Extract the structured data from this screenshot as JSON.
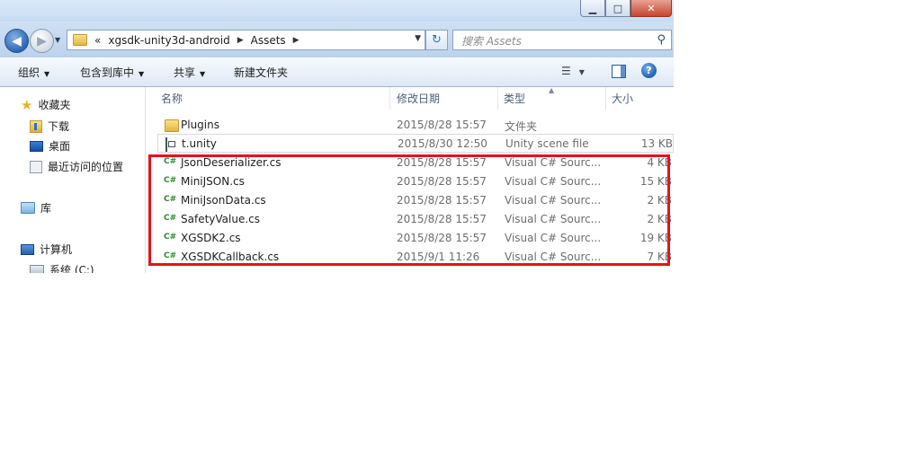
{
  "window": {
    "caption_buttons": {
      "minimize": "▁",
      "maximize": "□",
      "close": "✕"
    }
  },
  "address": {
    "overflow_marker": "«",
    "crumbs": [
      "xgsdk-unity3d-android",
      "Assets"
    ],
    "search_placeholder": "搜索 Assets"
  },
  "toolbar": {
    "organize": "组织",
    "include_in_library": "包含到库中",
    "share": "共享",
    "new_folder": "新建文件夹"
  },
  "nav": {
    "favorites": "收藏夹",
    "downloads": "下载",
    "desktop": "桌面",
    "recent": "最近访问的位置",
    "libraries": "库",
    "computer": "计算机",
    "drive_c": "系统 (C:)"
  },
  "columns": {
    "name": "名称",
    "date": "修改日期",
    "type": "类型",
    "size": "大小"
  },
  "files": [
    {
      "name": "Plugins",
      "date": "2015/8/28 15:57",
      "type": "文件夹",
      "size": "",
      "icon": "folder-icon"
    },
    {
      "name": "t.unity",
      "date": "2015/8/30 12:50",
      "type": "Unity scene file",
      "size": "13 KB",
      "icon": "unity-file-icon"
    },
    {
      "name": "JsonDeserializer.cs",
      "date": "2015/8/28 15:57",
      "type": "Visual C# Sourc...",
      "size": "4 KB",
      "icon": "csharp-file-icon"
    },
    {
      "name": "MiniJSON.cs",
      "date": "2015/8/28 15:57",
      "type": "Visual C# Sourc...",
      "size": "15 KB",
      "icon": "csharp-file-icon"
    },
    {
      "name": "MiniJsonData.cs",
      "date": "2015/8/28 15:57",
      "type": "Visual C# Sourc...",
      "size": "2 KB",
      "icon": "csharp-file-icon"
    },
    {
      "name": "SafetyValue.cs",
      "date": "2015/8/28 15:57",
      "type": "Visual C# Sourc...",
      "size": "2 KB",
      "icon": "csharp-file-icon"
    },
    {
      "name": "XGSDK2.cs",
      "date": "2015/8/28 15:57",
      "type": "Visual C# Sourc...",
      "size": "19 KB",
      "icon": "csharp-file-icon"
    },
    {
      "name": "XGSDKCallback.cs",
      "date": "2015/9/1 11:26",
      "type": "Visual C# Sourc...",
      "size": "7 KB",
      "icon": "csharp-file-icon"
    }
  ],
  "colors": {
    "highlight": "#e8111a",
    "titlebar": "#c6dbf2",
    "csharp_icon": "#2f8a2f"
  }
}
